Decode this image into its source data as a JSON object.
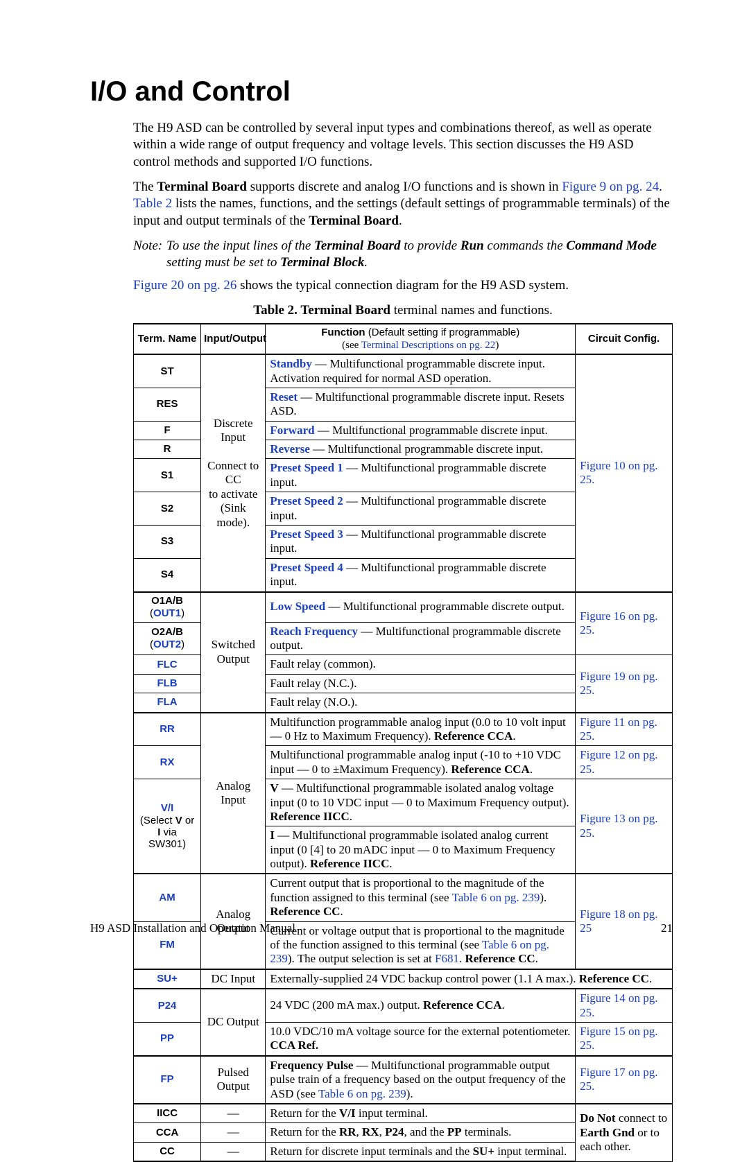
{
  "heading": "I/O and Control",
  "p1": {
    "t1": "The H9 ASD can be controlled by several input types and combinations thereof, as well as operate within a wide range of output frequency and voltage levels. This section discusses the H9 ASD control methods and supported I/O functions."
  },
  "p2": {
    "pre": "The ",
    "tb": "Terminal Board",
    "mid": " supports discrete and analog I/O functions and is shown in ",
    "link1": "Figure 9 on pg. 24",
    "post1": ". ",
    "link2": "Table 2",
    "post2": " lists the names, functions, and the settings (default settings of programmable terminals) of the input and output terminals of the ",
    "tb2": "Terminal Board",
    "end": "."
  },
  "note": {
    "label": "Note:",
    "l1a": "To use the input lines of the ",
    "l1b": "Terminal Board",
    "l1c": " to provide ",
    "l1d": "Run",
    "l1e": " commands the ",
    "l1f": "Command Mode",
    "l1g": " setting must be set to ",
    "l1h": "Terminal Block",
    "l1i": "."
  },
  "p3": {
    "link": "Figure 20 on pg. 26",
    "post": " shows the typical connection diagram for the H9 ASD system."
  },
  "caption": {
    "a": "Table 2. Terminal Board",
    "b": " terminal names and functions."
  },
  "head": {
    "c1": "Term. Name",
    "c2": "Input/Output",
    "c3a": "Function ",
    "c3b": "(Default setting if programmable)",
    "c3c": "(see ",
    "c3d": "Terminal Descriptions on pg. 22",
    "c3e": ")",
    "c4": "Circuit Config."
  },
  "io": {
    "discrete": "Discrete Input",
    "discrete2a": "Connect to CC",
    "discrete2b": "to activate",
    "discrete2c": "(Sink mode).",
    "switched": "Switched Output",
    "analogIn": "Analog Input",
    "analogOut": "Analog Output",
    "dcIn": "DC Input",
    "dcOut": "DC Output",
    "pulsed": "Pulsed Output",
    "dash": "—"
  },
  "cfg": {
    "f10": "Figure 10 on pg. 25.",
    "f16": "Figure 16 on pg. 25.",
    "f19": "Figure 19 on pg. 25.",
    "f11": "Figure 11 on pg. 25.",
    "f12": "Figure 12 on pg. 25.",
    "f13": "Figure 13 on pg. 25.",
    "f18": "Figure 18 on pg. 25",
    "f14": "Figure 14 on pg. 25.",
    "f15": "Figure 15 on pg. 25.",
    "f17": "Figure 17 on pg. 25.",
    "donot1": "Do Not",
    "donot2": " connect to ",
    "donot3": "Earth Gnd",
    "donot4": " or to each other."
  },
  "rows": {
    "st": {
      "name": "ST",
      "fn_b": "Standby",
      "fn_t": " — Multifunctional programmable discrete input. Activation required for normal ASD operation."
    },
    "res": {
      "name": "RES",
      "fn_b": "Reset",
      "fn_t": " — Multifunctional programmable discrete input. Resets ASD."
    },
    "f": {
      "name": "F",
      "fn_b": "Forward",
      "fn_t": " — Multifunctional programmable discrete input."
    },
    "r": {
      "name": "R",
      "fn_b": "Reverse",
      "fn_t": " — Multifunctional programmable discrete input."
    },
    "s1": {
      "name": "S1",
      "fn_b": "Preset Speed 1",
      "fn_t": " — Multifunctional programmable discrete input."
    },
    "s2": {
      "name": "S2",
      "fn_b": "Preset Speed 2",
      "fn_t": " — Multifunctional programmable discrete input."
    },
    "s3": {
      "name": "S3",
      "fn_b": "Preset Speed 3",
      "fn_t": " — Multifunctional programmable discrete input."
    },
    "s4": {
      "name": "S4",
      "fn_b": "Preset Speed 4",
      "fn_t": " — Multifunctional programmable discrete input."
    },
    "o1": {
      "name_a": "O1A/B",
      "name_b": " (",
      "name_c": "OUT1",
      "name_d": ")",
      "fn_b": "Low Speed",
      "fn_t": " — Multifunctional programmable discrete output."
    },
    "o2": {
      "name_a": "O2A/B",
      "name_b": " (",
      "name_c": "OUT2",
      "name_d": ")",
      "fn_b": "Reach Frequency",
      "fn_t": " — Multifunctional programmable discrete output."
    },
    "flc": {
      "name": "FLC",
      "fn_t": "Fault relay (common)."
    },
    "flb": {
      "name": "FLB",
      "fn_t": "Fault relay (N.C.)."
    },
    "fla": {
      "name": "FLA",
      "fn_t": "Fault relay (N.O.)."
    },
    "rr": {
      "name": "RR",
      "fn_t1": "Multifunction programmable analog input (0.0 to 10 volt input — 0 Hz to Maximum Frequency). ",
      "fn_b1": "Reference CCA",
      "fn_t2": "."
    },
    "rx": {
      "name": "RX",
      "fn_t1": "Multifunctional programmable analog input (-10 to +10 VDC input — 0 to ±Maximum Frequency). ",
      "fn_b1": "Reference CCA",
      "fn_t2": "."
    },
    "vi": {
      "name_line1": "V/I",
      "name_line2_a": "(Select ",
      "name_line2_b": "V",
      "name_line2_c": " or ",
      "name_line2_d": "I",
      "name_line2_e": " via SW301)",
      "v_b": "V",
      "v_t": " — Multifunctional programmable isolated analog voltage input (0 to 10 VDC input — 0 to Maximum Frequency output). ",
      "v_b2": "Reference IICC",
      "v_t2": ".",
      "i_b": "I",
      "i_t": " — Multifunctional programmable isolated analog current input (0 [4] to 20 mADC input — 0 to Maximum Frequency output). ",
      "i_b2": "Reference IICC",
      "i_t2": "."
    },
    "am": {
      "name": "AM",
      "fn_t1": "Current output that is proportional to the magnitude of the function assigned to this terminal (see ",
      "fn_l": "Table 6 on pg. 239",
      "fn_t2": "). ",
      "fn_b": "Reference CC",
      "fn_t3": "."
    },
    "fm": {
      "name": "FM",
      "fn_t1": "Current or voltage output that is proportional to the magnitude of the function assigned to this terminal (see ",
      "fn_l1": "Table 6 on pg. 239",
      "fn_t2": "). The output selection is set at ",
      "fn_l2": "F681",
      "fn_t3": ". ",
      "fn_b": "Reference CC",
      "fn_t4": "."
    },
    "su": {
      "name": "SU+",
      "fn_t1": "Externally-supplied 24 VDC backup control power (1.1 A max.). ",
      "fn_b": "Reference CC",
      "fn_t2": "."
    },
    "p24": {
      "name": "P24",
      "fn_t1": "24 VDC (200 mA max.) output. ",
      "fn_b": "Reference CCA",
      "fn_t2": "."
    },
    "pp": {
      "name": "PP",
      "fn_t1": "10.0 VDC/10 mA voltage source for the external potentiometer. ",
      "fn_b": "CCA Ref.",
      "fn_t2": ""
    },
    "fp": {
      "name": "FP",
      "fn_b": "Frequency Pulse",
      "fn_t1": " — Multifunctional programmable output pulse train of a frequency based on the output frequency of the ASD (see ",
      "fn_l": "Table 6 on pg. 239",
      "fn_t2": ")."
    },
    "iicc": {
      "name": "IICC",
      "fn_t1": "Return for the ",
      "fn_b": "V/I",
      "fn_t2": " input terminal."
    },
    "cca": {
      "name": "CCA",
      "fn_t1": "Return for the ",
      "fn_b1": "RR",
      "fn_t2": ", ",
      "fn_b2": "RX",
      "fn_t3": ", ",
      "fn_b3": "P24",
      "fn_t4": ", and the ",
      "fn_b4": "PP",
      "fn_t5": " terminals."
    },
    "cc": {
      "name": "CC",
      "fn_t1": "Return for discrete input terminals and the ",
      "fn_b": "SU+",
      "fn_t2": " input terminal."
    }
  },
  "footer": {
    "left": "H9 ASD Installation and Operation Manual",
    "right": "21"
  }
}
